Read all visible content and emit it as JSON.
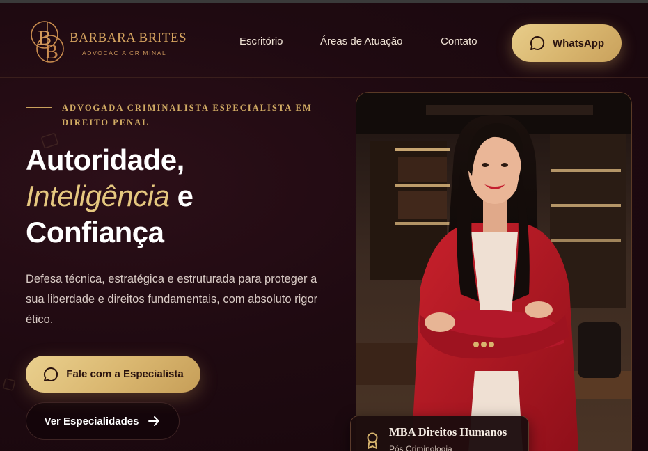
{
  "brand": {
    "monogram": "BB",
    "name": "BARBARA BRITES",
    "subtitle": "ADVOCACIA CRIMINAL"
  },
  "nav": {
    "items": [
      {
        "label": "Escritório"
      },
      {
        "label": "Áreas de Atuação"
      },
      {
        "label": "Contato"
      }
    ],
    "whatsapp_label": "WhatsApp"
  },
  "hero": {
    "eyebrow": "ADVOGADA CRIMINALISTA ESPECIALISTA EM DIREITO PENAL",
    "headline_1": "Autoridade,",
    "headline_accent": "Inteligência",
    "headline_2": " e",
    "headline_3": "Confiança",
    "lead": "Defesa técnica, estratégica e estruturada para proteger a sua liberdade e direitos fundamentais, com absoluto rigor ético.",
    "cta_primary": "Fale com a Especialista",
    "cta_secondary": "Ver Especialidades"
  },
  "badge": {
    "title": "MBA Direitos Humanos",
    "subtitle": "Pós Criminologia"
  },
  "icons": {
    "whatsapp": "chat-bubble-icon",
    "arrow": "arrow-right-icon",
    "award": "award-icon"
  },
  "colors": {
    "background": "#1e0a10",
    "gold": "#d8b56e",
    "accent_text": "#e5c77f",
    "dark_text": "#2a130e"
  }
}
